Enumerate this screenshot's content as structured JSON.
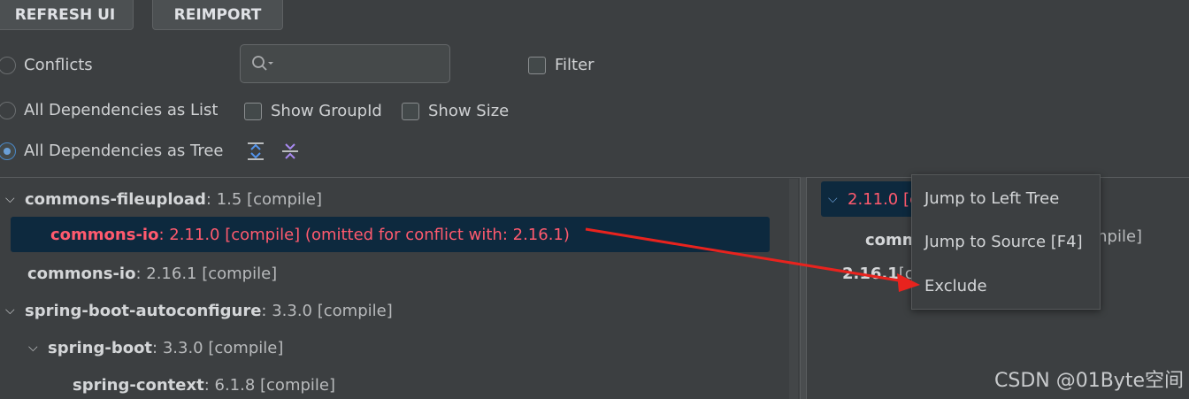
{
  "toolbar": {
    "refresh_label": "REFRESH UI",
    "reimport_label": "REIMPORT"
  },
  "options": {
    "conflicts_label": "Conflicts",
    "list_label": "All Dependencies as List",
    "tree_label": "All Dependencies as Tree",
    "filter_label": "Filter",
    "show_groupid_label": "Show GroupId",
    "show_size_label": "Show Size",
    "selected_view": "All Dependencies as Tree"
  },
  "search": {
    "value": "",
    "placeholder": ""
  },
  "left_tree": [
    {
      "name": "commons-fileupload",
      "rest": " : 1.5 [compile]",
      "expanded": true
    },
    {
      "name": "commons-io",
      "rest": " : 2.11.0 [compile] (omitted for conflict with: 2.16.1)",
      "conflict": true,
      "selected": true
    },
    {
      "name": "commons-io",
      "rest": " : 2.16.1 [compile]"
    },
    {
      "name": "spring-boot-autoconfigure",
      "rest": " : 3.3.0 [compile]",
      "expanded": true
    },
    {
      "name": "spring-boot",
      "rest": " : 3.3.0 [compile]",
      "expanded": true
    },
    {
      "name": "spring-context",
      "rest": " : 6.1.8 [compile]"
    }
  ],
  "right_tree": {
    "row1": "2.11.0 [co",
    "row2_name": "comm",
    "row2_rest": "mpile]",
    "row3_name": "2.16.1",
    "row3_rest": " [c"
  },
  "context_menu": {
    "items": [
      "Jump to Left Tree",
      "Jump to Source [F4]",
      "Exclude"
    ]
  },
  "watermark": "CSDN @01Byte空间",
  "colors": {
    "conflict": "#ff5a6e",
    "selection": "#0d293e",
    "arrow": "#e8231e"
  }
}
